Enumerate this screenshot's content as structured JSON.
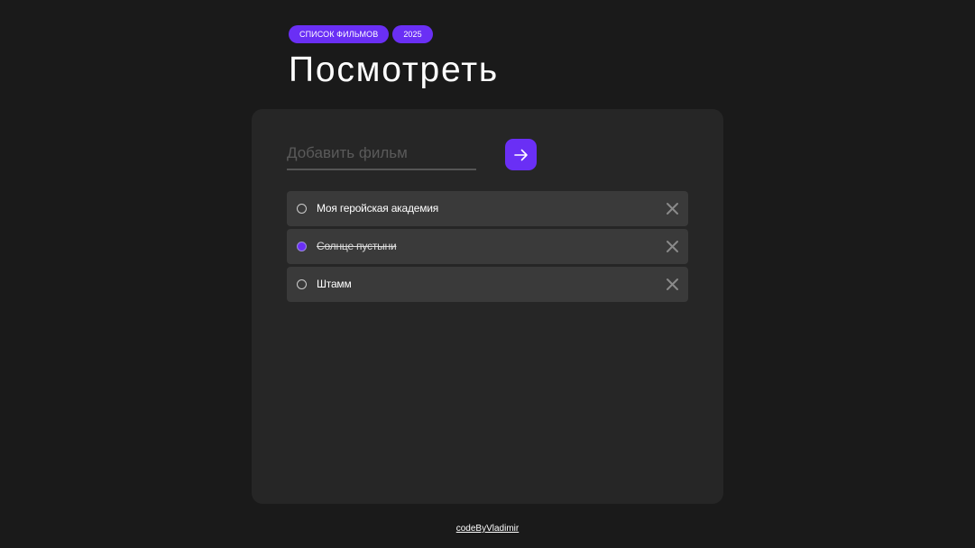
{
  "header": {
    "badges": [
      "СПИСОК ФИЛЬМОВ",
      "2025"
    ],
    "title": "Посмотреть"
  },
  "form": {
    "placeholder": "Добавить фильм",
    "value": "",
    "submit_icon": "arrow-right-icon"
  },
  "movies": [
    {
      "title": "Моя геройская академия",
      "watched": false,
      "remove_icon": "close-icon"
    },
    {
      "title": "Солнце пустыни",
      "watched": true,
      "remove_icon": "close-icon"
    },
    {
      "title": "Штамм",
      "watched": false,
      "remove_icon": "close-icon"
    }
  ],
  "footer": {
    "link_text": "codeByVladimir"
  },
  "colors": {
    "background": "#1a1a1a",
    "card": "#262626",
    "item": "#3a3a3a",
    "accent": "#6a2ff5"
  }
}
